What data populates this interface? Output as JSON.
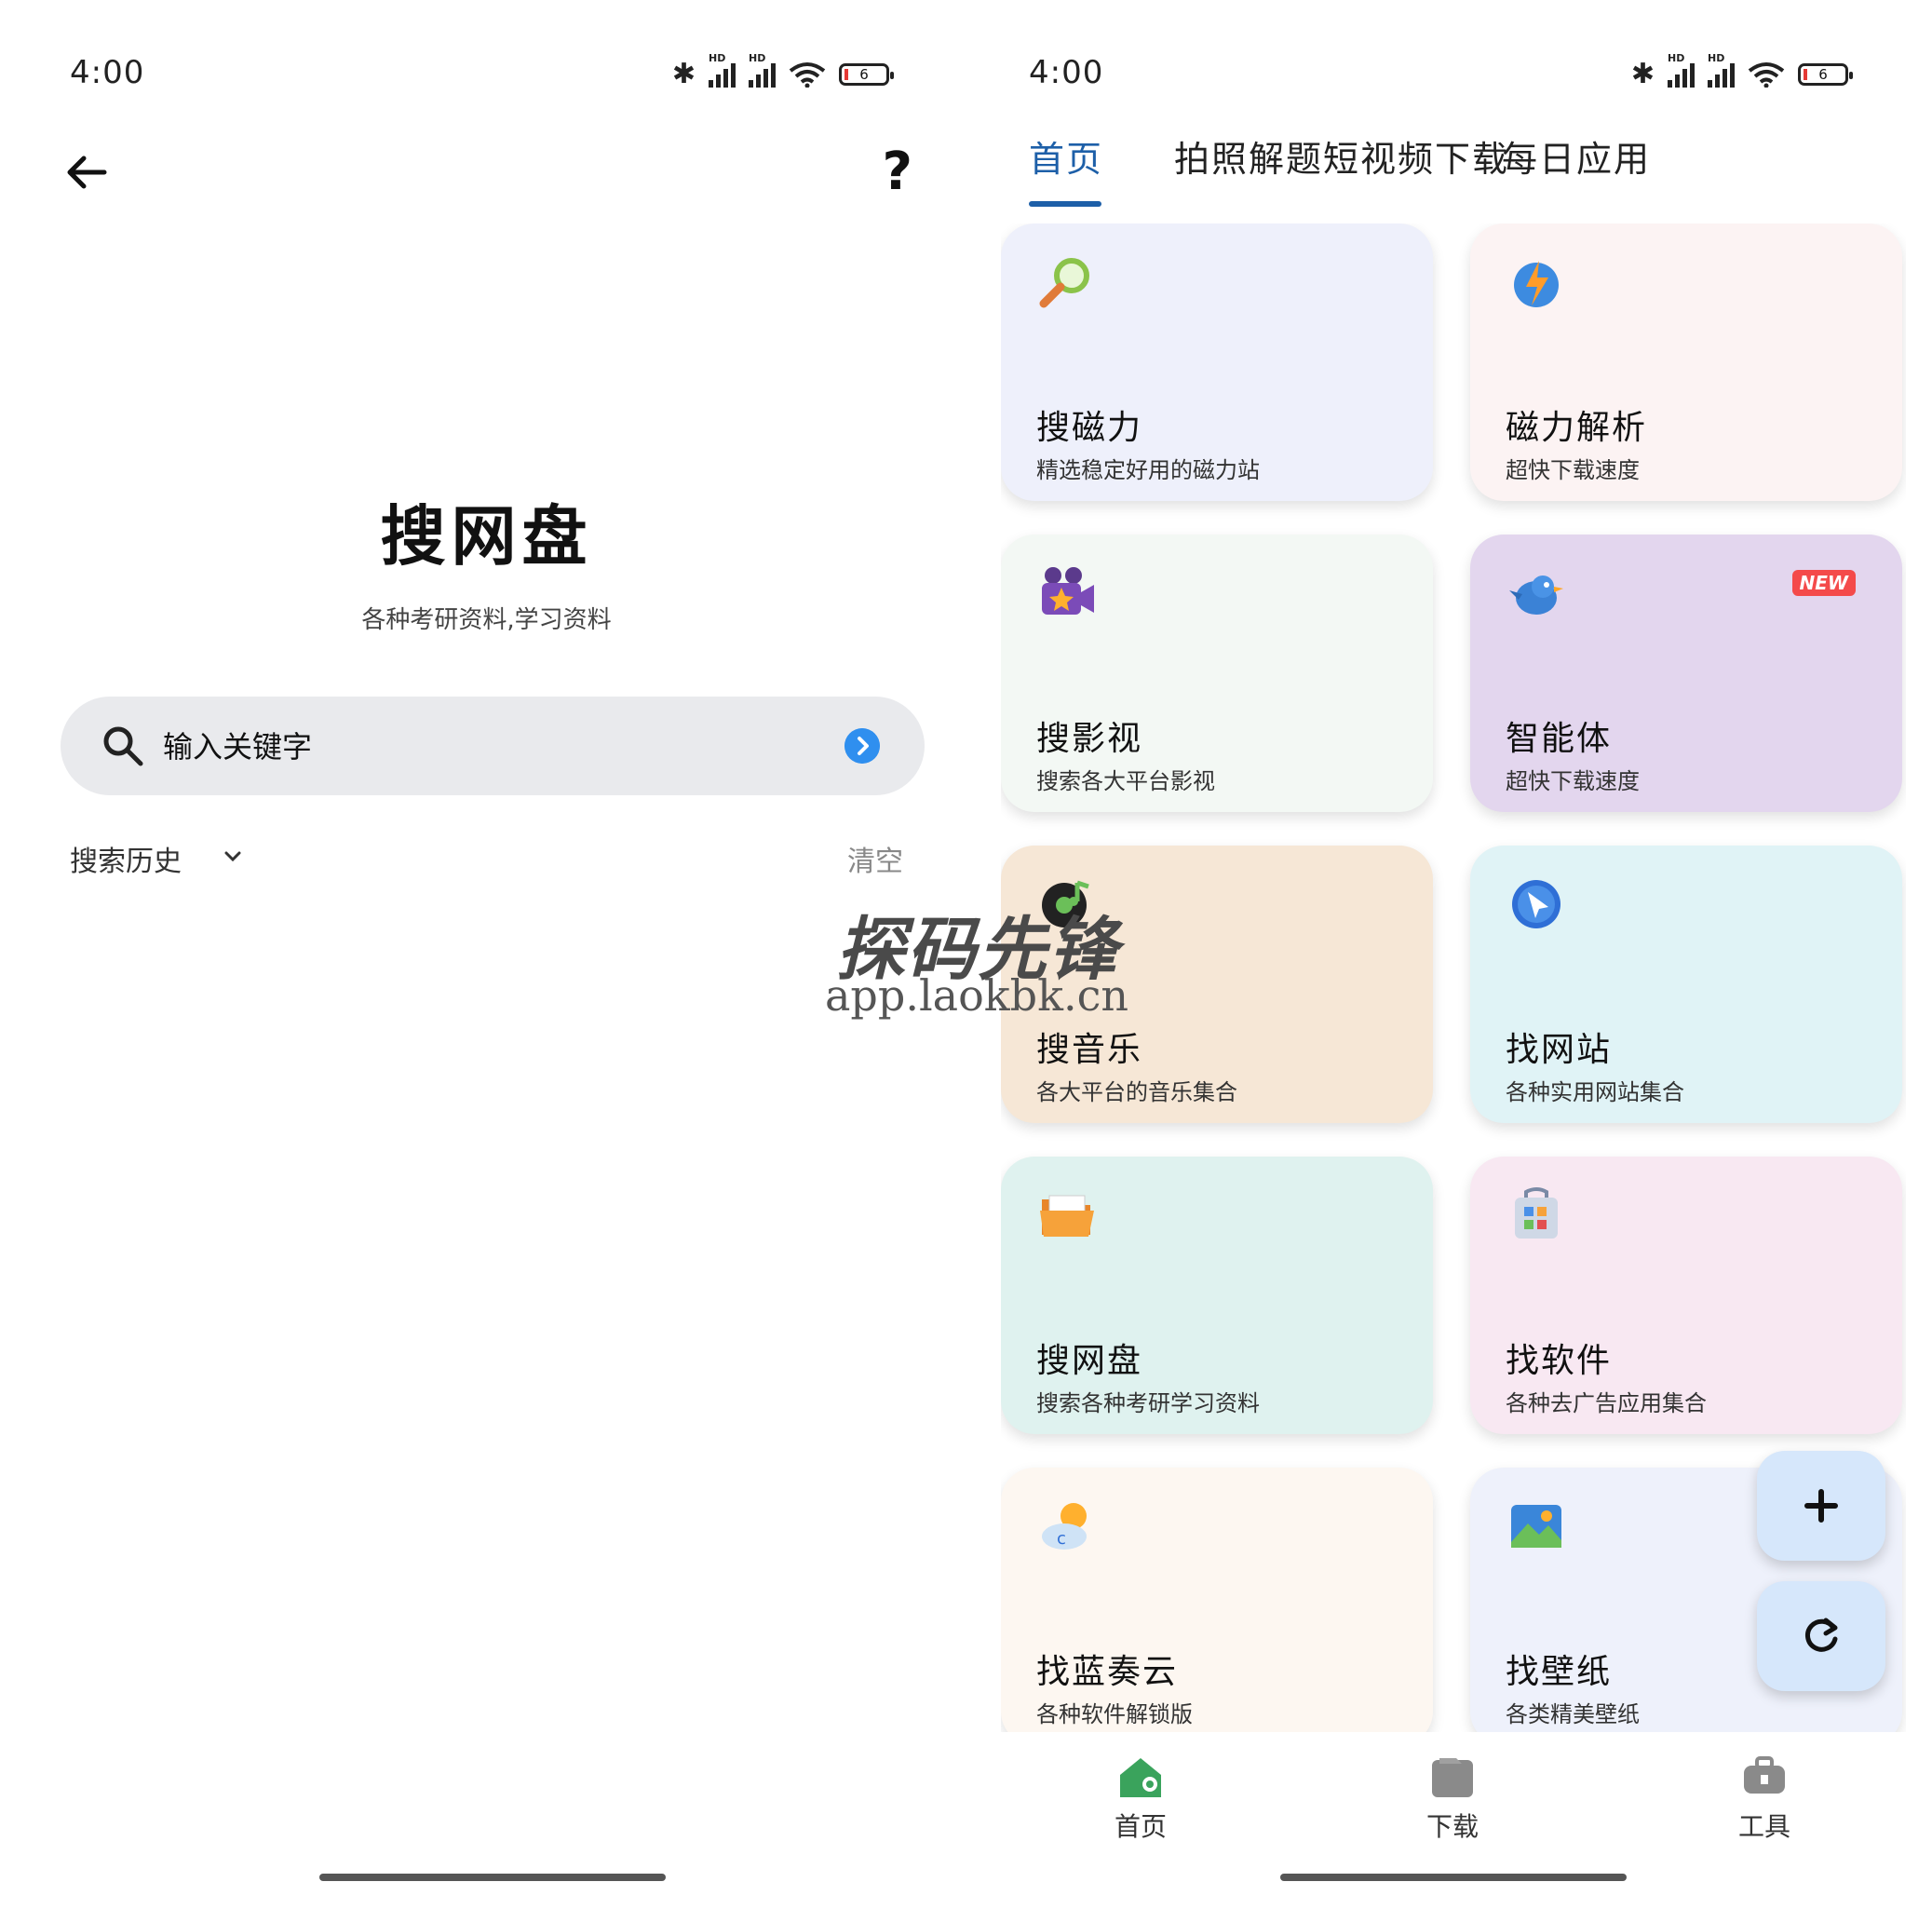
{
  "left_screen": {
    "status": {
      "time": "4:00",
      "battery": "6",
      "hd": "HD"
    },
    "title": "搜网盘",
    "subtitle": "各种考研资料,学习资料",
    "search": {
      "placeholder": "输入关键字"
    },
    "history_label": "搜索历史",
    "clear_label": "清空"
  },
  "right_screen": {
    "status": {
      "time": "4:00",
      "battery": "6",
      "hd": "HD"
    },
    "tabs": [
      {
        "label": "首页",
        "active": true
      },
      {
        "label": "拍照解题",
        "active": false
      },
      {
        "label": "短视频下载",
        "active": false
      },
      {
        "label": "每日应用",
        "active": false
      }
    ],
    "cards": [
      {
        "title": "搜磁力",
        "desc": "精选稳定好用的磁力站",
        "icon": "magnifier-icon",
        "bg": "#eef0fb"
      },
      {
        "title": "磁力解析",
        "desc": "超快下载速度",
        "icon": "lightning-chat-icon",
        "bg": "#fcf3f3"
      },
      {
        "title": "搜影视",
        "desc": "搜索各大平台影视",
        "icon": "movie-camera-icon",
        "bg": "#f3f8f4"
      },
      {
        "title": "智能体",
        "desc": "超快下载速度",
        "icon": "bird-icon",
        "bg": "#e3d6ee",
        "badge": "NEW"
      },
      {
        "title": "搜音乐",
        "desc": "各大平台的音乐集合",
        "icon": "music-disc-icon",
        "bg": "#f6e7d6"
      },
      {
        "title": "找网站",
        "desc": "各种实用网站集合",
        "icon": "compass-icon",
        "bg": "#e0f3f6"
      },
      {
        "title": "搜网盘",
        "desc": "搜索各种考研学习资料",
        "icon": "folder-icon",
        "bg": "#dff2ef"
      },
      {
        "title": "找软件",
        "desc": "各种去广告应用集合",
        "icon": "app-store-icon",
        "bg": "#f8e8f2"
      },
      {
        "title": "找蓝奏云",
        "desc": "各种软件解锁版",
        "icon": "weather-cloud-icon",
        "bg": "#fdf7f1"
      },
      {
        "title": "找壁纸",
        "desc": "各类精美壁纸",
        "icon": "picture-icon",
        "bg": "#eef1fb"
      }
    ],
    "fabs": [
      {
        "name": "add",
        "icon": "plus-icon"
      },
      {
        "name": "refresh",
        "icon": "refresh-icon"
      }
    ],
    "bottom_nav": [
      {
        "label": "首页",
        "icon": "home-icon",
        "color": "#3aa35c"
      },
      {
        "label": "下载",
        "icon": "download-folder-icon",
        "color": "#888888"
      },
      {
        "label": "工具",
        "icon": "toolbox-icon",
        "color": "#888888"
      }
    ]
  },
  "watermark": {
    "brand": "探码先锋",
    "url": "app.laokbk.cn"
  },
  "colors": {
    "accent": "#1d5fa8",
    "go_button": "#2f8fef",
    "fab": "#d6e7fb"
  }
}
